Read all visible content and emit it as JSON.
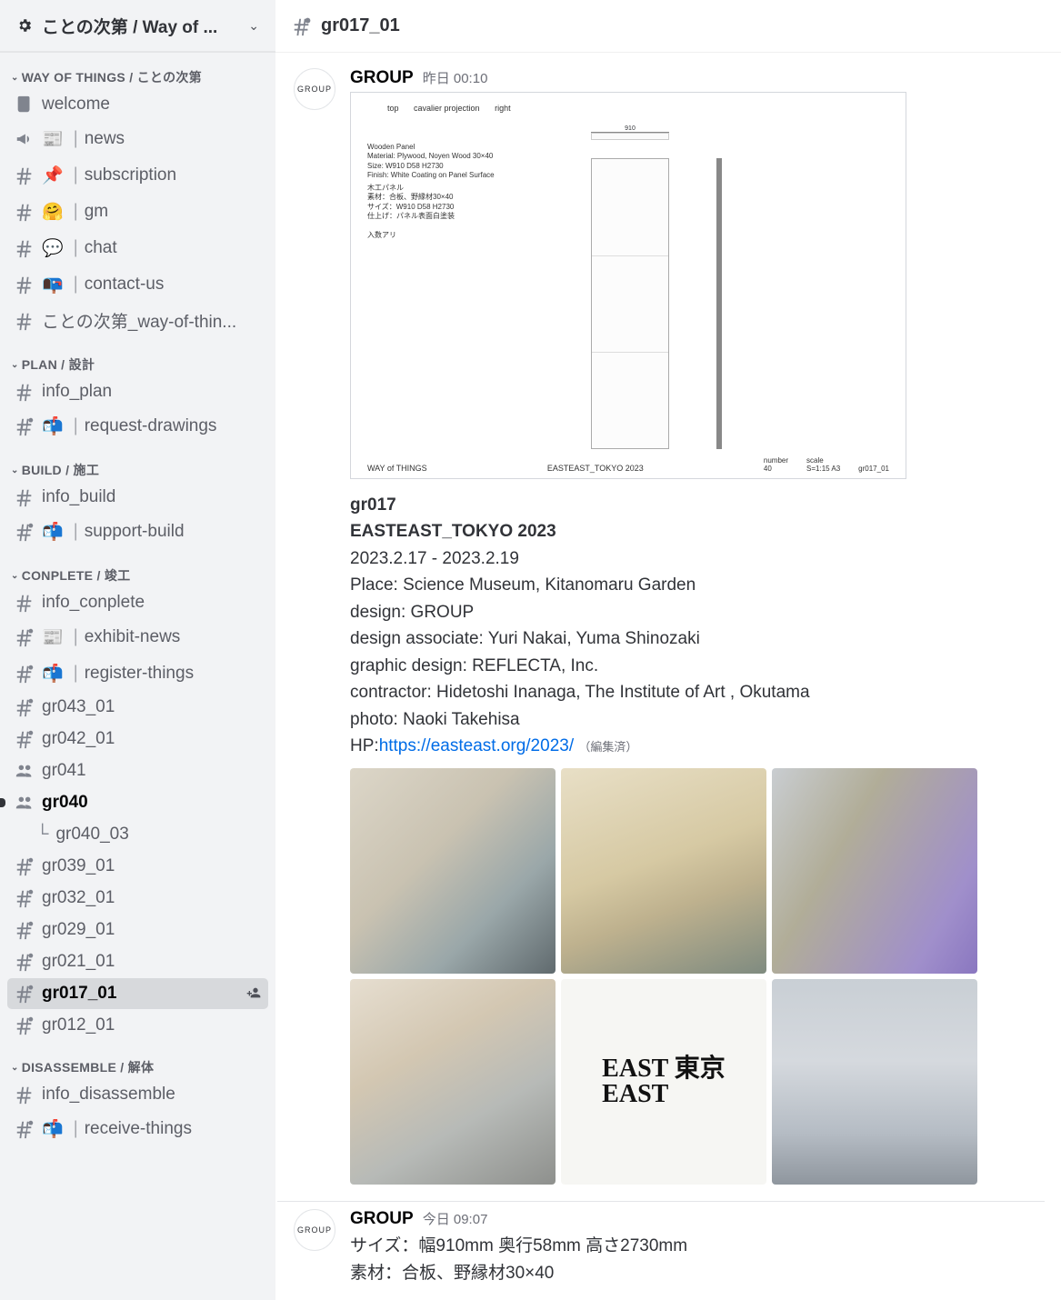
{
  "server": {
    "name": "ことの次第 / Way of ..."
  },
  "channel_header": {
    "name": "gr017_01"
  },
  "sidebar": {
    "categories": [
      {
        "name": "WAY OF THINGS / ことの次第",
        "channels": [
          {
            "icon": "scroll",
            "emoji": "",
            "label": "welcome",
            "type": "scroll"
          },
          {
            "icon": "megaphone",
            "emoji": "📰",
            "bar": "｜",
            "label": "news",
            "type": "megaphone"
          },
          {
            "icon": "hash",
            "emoji": "📌",
            "bar": "｜",
            "label": "subscription"
          },
          {
            "icon": "hash",
            "emoji": "🤗",
            "bar": "｜",
            "label": "gm"
          },
          {
            "icon": "hash",
            "emoji": "💬",
            "bar": "｜",
            "label": "chat"
          },
          {
            "icon": "hash",
            "emoji": "📭",
            "bar": "｜",
            "label": "contact-us"
          },
          {
            "icon": "hash",
            "emoji": "",
            "label": "ことの次第_way-of-thin..."
          }
        ]
      },
      {
        "name": "PLAN / 設計",
        "channels": [
          {
            "icon": "hash",
            "label": "info_plan"
          },
          {
            "icon": "hash-lock",
            "emoji": "📬",
            "bar": "｜",
            "label": "request-drawings"
          }
        ]
      },
      {
        "name": "BUILD / 施工",
        "channels": [
          {
            "icon": "hash",
            "label": "info_build"
          },
          {
            "icon": "hash-lock",
            "emoji": "📬",
            "bar": "｜",
            "label": "support-build"
          }
        ]
      },
      {
        "name": "CONPLETE / 竣工",
        "channels": [
          {
            "icon": "hash",
            "label": "info_conplete"
          },
          {
            "icon": "hash-lock",
            "emoji": "📰",
            "bar": "｜",
            "label": "exhibit-news"
          },
          {
            "icon": "hash-lock",
            "emoji": "📬",
            "bar": "｜",
            "label": "register-things"
          },
          {
            "icon": "hash-lock",
            "label": "gr043_01"
          },
          {
            "icon": "hash-lock",
            "label": "gr042_01"
          },
          {
            "icon": "people",
            "label": "gr041"
          },
          {
            "icon": "people",
            "label": "gr040",
            "unread": true,
            "thread": "gr040_03"
          },
          {
            "icon": "hash-lock",
            "label": "gr039_01"
          },
          {
            "icon": "hash-lock",
            "label": "gr032_01"
          },
          {
            "icon": "hash-lock",
            "label": "gr029_01"
          },
          {
            "icon": "hash-lock",
            "label": "gr021_01"
          },
          {
            "icon": "hash-lock",
            "label": "gr017_01",
            "active": true
          },
          {
            "icon": "hash-lock",
            "label": "gr012_01"
          }
        ]
      },
      {
        "name": "DISASSEMBLE / 解体",
        "channels": [
          {
            "icon": "hash",
            "label": "info_disassemble"
          },
          {
            "icon": "hash-lock",
            "emoji": "📬",
            "bar": "｜",
            "label": "receive-things"
          }
        ]
      }
    ]
  },
  "messages": [
    {
      "avatar_text": "GROUP",
      "user": "GROUP",
      "time_prefix": "昨日",
      "time": "00:10",
      "drawing": {
        "top_proj": [
          "top",
          "cavalier projection",
          "right"
        ],
        "spec_en": "Wooden Panel\nMaterial: Plywood, Noyen Wood 30×40\nSize: W910 D58 H2730\nFinish: White Coating on Panel Surface",
        "spec_jp": "木工パネル\n素材：合板、野縁材30×40\nサイズ：W910 D58 H2730\n仕上げ：パネル表面白塗装\n\n入数アリ",
        "dim_w": "910",
        "footer_left": "WAY of THINGS",
        "footer_mid": "EASTEAST_TOKYO 2023",
        "footer_r1_label": "number",
        "footer_r1_val": "40",
        "footer_r2_label": "scale",
        "footer_r2_val": "S=1:15 A3",
        "footer_r3": "gr017_01"
      },
      "body": {
        "title_small": "gr017",
        "title_big": "EASTEAST_TOKYO 2023",
        "dates": "2023.2.17 - 2023.2.19",
        "place": "Place: Science Museum, Kitanomaru Garden",
        "design": "design: GROUP",
        "assoc": "design associate: Yuri Nakai, Yuma Shinozaki",
        "graphic": "graphic design: REFLECTA, Inc.",
        "contractor": "contractor: Hidetoshi Inanaga, The Institute of Art , Okutama",
        "photo": "photo: Naoki Takehisa",
        "hp_label": "HP:",
        "hp_url": "https://easteast.org/2023/",
        "edited": "（編集済）"
      },
      "sign": {
        "line1": "EAST 東京",
        "line2": "EAST"
      }
    },
    {
      "avatar_text": "GROUP",
      "user": "GROUP",
      "time_prefix": "今日",
      "time": "09:07",
      "lines": [
        "サイズ：幅910mm 奥行58mm 高さ2730mm",
        "素材：合板、野縁材30×40"
      ]
    }
  ]
}
